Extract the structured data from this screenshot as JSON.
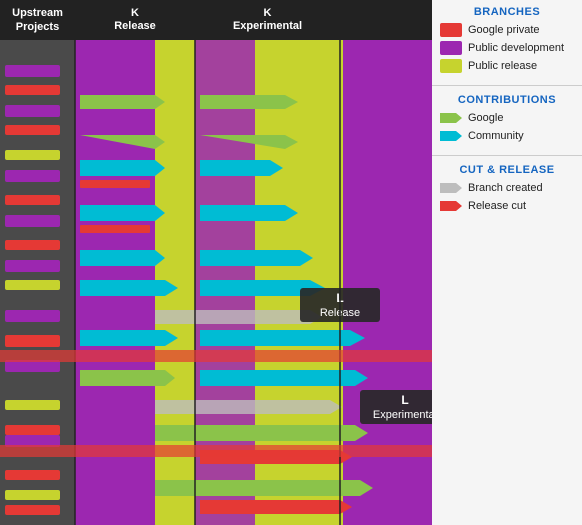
{
  "header": {
    "upstream_label": "Upstream Projects",
    "k_release_label": "K",
    "k_release_sub": "Release",
    "k_experimental_label": "K",
    "k_experimental_sub": "Experimental"
  },
  "legend": {
    "branches_title": "BRANCHES",
    "contributions_title": "CONTRIBUTIONS",
    "cut_release_title": "CUT & RELEASE",
    "items": {
      "google_private": "Google private",
      "public_development": "Public development",
      "public_release": "Public release",
      "google": "Google",
      "community": "Community",
      "branch_created": "Branch created",
      "release_cut": "Release cut"
    },
    "colors": {
      "google_private": "#e53935",
      "public_development": "#9c27b0",
      "public_release": "#c6d32e",
      "google": "#8bc34a",
      "community": "#00bcd4",
      "branch_created": "#bdbdbd",
      "release_cut": "#e53935"
    }
  },
  "tooltips": {
    "l_release": "L\nRelease",
    "l_experimental": "L\nExperimental"
  }
}
